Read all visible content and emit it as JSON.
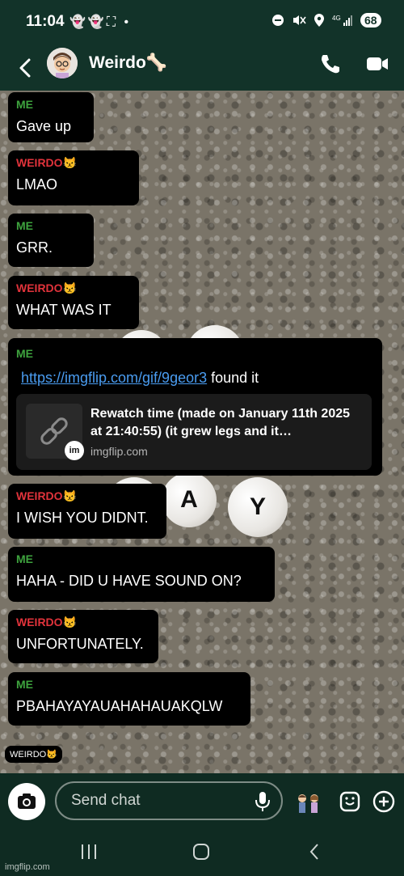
{
  "status_bar": {
    "time": "11:04",
    "left_icons": "👻👻⛶ •",
    "battery": "68"
  },
  "header": {
    "contact_name": "Weirdo🦴"
  },
  "messages": [
    {
      "sender": "ME",
      "text": "Gave up"
    },
    {
      "sender": "WEIRDO😾",
      "text": "LMAO"
    },
    {
      "sender": "ME",
      "text": "GRR."
    },
    {
      "sender": "WEIRDO😾",
      "text": "WHAT WAS IT"
    },
    {
      "sender": "ME",
      "link": "https://imgflip.com/gif/9geor3",
      "after_link": " found it"
    },
    {
      "sender": "WEIRDO😾",
      "text": "I WISH YOU DIDNT."
    },
    {
      "sender": "ME",
      "text": "HAHA - DID U HAVE SOUND ON?"
    },
    {
      "sender": "WEIRDO😾",
      "text": "UNFORTUNATELY."
    },
    {
      "sender": "ME",
      "text": "PBAHAYAYAUAHAHAUAKQLW"
    }
  ],
  "link_preview": {
    "title": "Rewatch time (made on January 11th 2025 at 21:40:55) (it grew legs and it…",
    "domain": "imgflip.com",
    "logo_text": "im"
  },
  "background_beads": [
    "A",
    "Y"
  ],
  "typing_indicator": "WEIRDO😾",
  "input": {
    "placeholder": "Send chat"
  },
  "watermark": "imgflip.com",
  "colors": {
    "me": "#3ea33e",
    "weirdo": "#e1333b",
    "link": "#4a9cf0",
    "bar_bg": "#123329"
  }
}
